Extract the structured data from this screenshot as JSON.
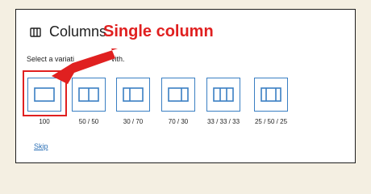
{
  "panel": {
    "title": "Columns",
    "title_icon": "columns-icon",
    "instructions": "Select a variation to start with.",
    "instructions_visible": "Select a variati",
    "instructions_tail": "vith."
  },
  "variations": [
    {
      "label": "100",
      "icon": "one-column-icon"
    },
    {
      "label": "50 / 50",
      "icon": "two-columns-equal-icon"
    },
    {
      "label": "30 / 70",
      "icon": "two-columns-30-70-icon"
    },
    {
      "label": "70 / 30",
      "icon": "two-columns-70-30-icon"
    },
    {
      "label": "33 / 33 / 33",
      "icon": "three-columns-equal-icon"
    },
    {
      "label": "25 / 50 / 25",
      "icon": "three-columns-wide-center-icon"
    }
  ],
  "skip_label": "Skip",
  "annotation": {
    "text": "Single column",
    "color": "#e02020"
  },
  "colors": {
    "accent": "#3a7fc3",
    "link": "#2a6fb5",
    "annotation": "#e02020",
    "background": "#f4efe2"
  }
}
